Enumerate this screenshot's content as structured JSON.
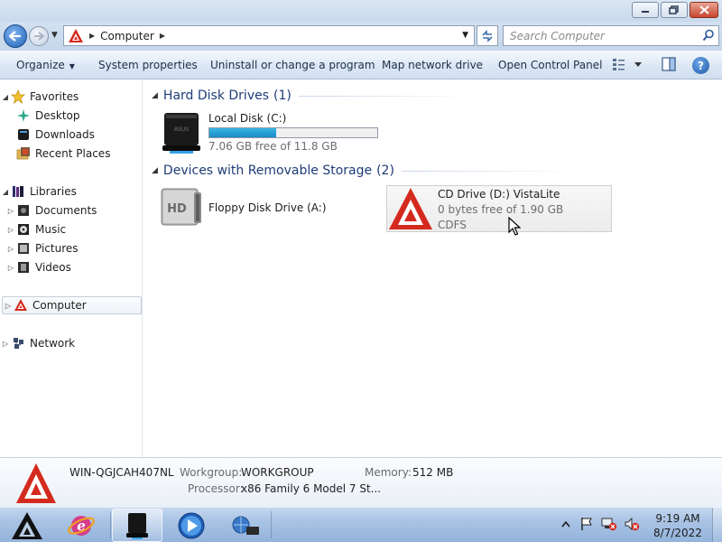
{
  "window": {
    "caption_buttons": [
      "minimize",
      "maximize",
      "close"
    ]
  },
  "address_bar": {
    "breadcrumb": [
      "Computer"
    ],
    "search_placeholder": "Search Computer"
  },
  "command_bar": {
    "organize": "Organize",
    "system_properties": "System properties",
    "uninstall": "Uninstall or change a program",
    "map_drive": "Map network drive",
    "control_panel": "Open Control Panel",
    "help": "?"
  },
  "nav_pane": {
    "favorites": {
      "label": "Favorites",
      "children": [
        "Desktop",
        "Downloads",
        "Recent Places"
      ]
    },
    "libraries": {
      "label": "Libraries",
      "children": [
        "Documents",
        "Music",
        "Pictures",
        "Videos"
      ]
    },
    "computer": "Computer",
    "network": "Network"
  },
  "groups": [
    {
      "title": "Hard Disk Drives",
      "count": "(1)",
      "items": [
        {
          "name": "Local Disk (C:)",
          "free_text": "7.06 GB free of 11.8 GB",
          "used_fraction": 0.4
        }
      ]
    },
    {
      "title": "Devices with Removable Storage",
      "count": "(2)",
      "items": [
        {
          "name": "Floppy Disk Drive (A:)"
        },
        {
          "name": "CD Drive (D:) VistaLite",
          "free_text": "0 bytes free of 1.90 GB",
          "filesystem": "CDFS"
        }
      ]
    }
  ],
  "details": {
    "computer_name": "WIN-QGJCAH407NL",
    "workgroup_label": "Workgroup:",
    "workgroup_value": "WORKGROUP",
    "memory_label": "Memory:",
    "memory_value": "512 MB",
    "processor_label": "Processor:",
    "processor_value": "x86 Family 6 Model 7 St..."
  },
  "taskbar": {
    "items": [
      "start-logo",
      "internet-explorer",
      "explorer-drive",
      "media-player",
      "network-tool"
    ],
    "clock_time": "9:19 AM",
    "clock_date": "8/7/2022"
  },
  "colors": {
    "accent_red": "#d42a1e",
    "capacity_fill": "#26a3dc",
    "group_title": "#1e3c78"
  }
}
